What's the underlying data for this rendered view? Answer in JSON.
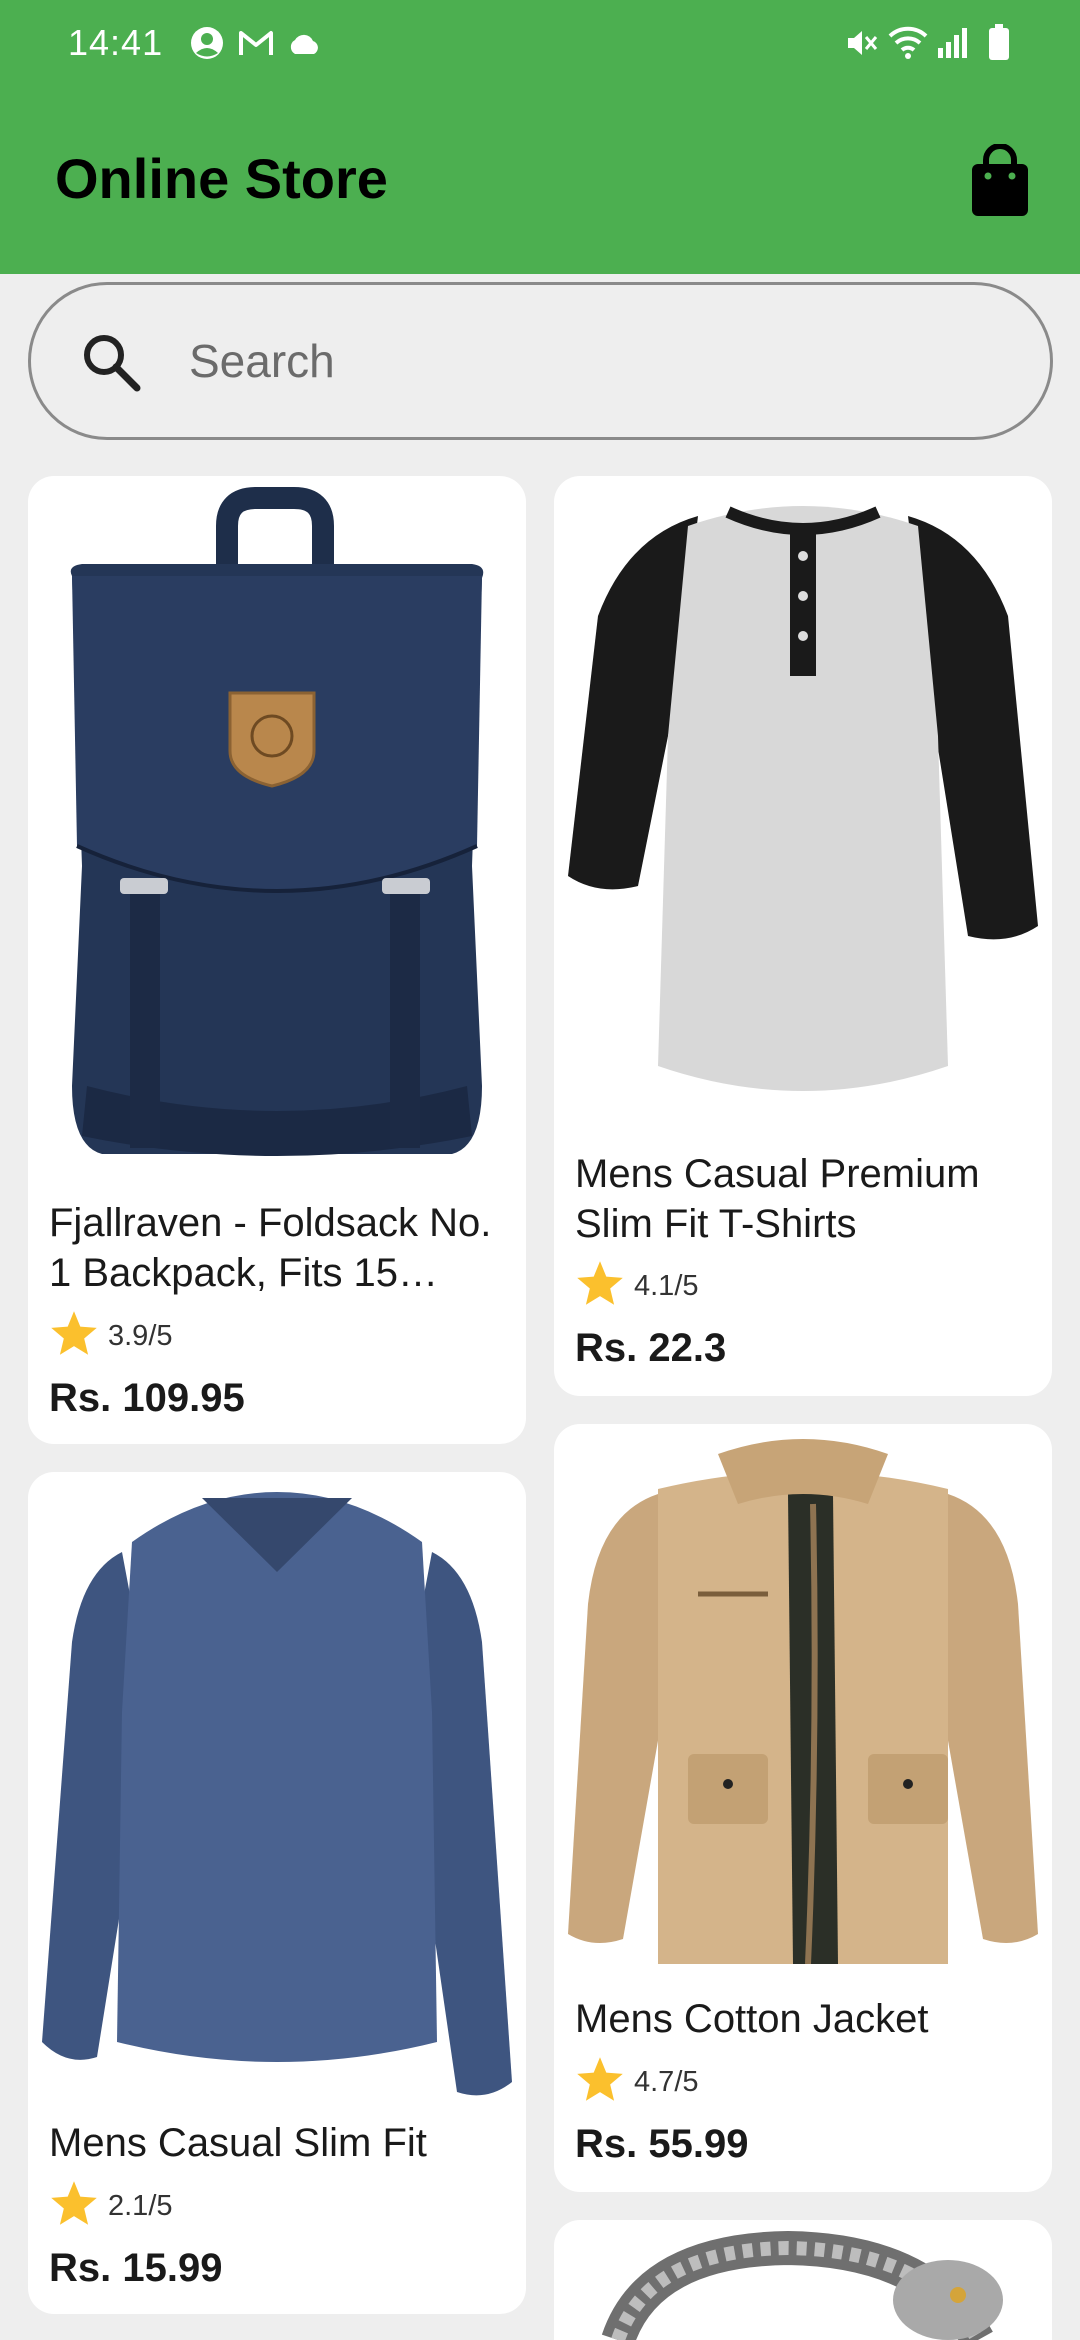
{
  "status_bar": {
    "time": "14:41",
    "icons": [
      "account-circle-icon",
      "gmail-icon",
      "cloud-icon",
      "mute-icon",
      "wifi-icon",
      "signal-icon",
      "battery-icon"
    ]
  },
  "app_bar": {
    "title": "Online Store",
    "cart_icon": "shopping-bag-icon",
    "color": "#4caf50"
  },
  "search": {
    "placeholder": "Search",
    "value": ""
  },
  "products": [
    {
      "name": "Fjallraven - Foldsack No. 1 Backpack, Fits 15 Laptops",
      "rating": "3.9/5",
      "price": "Rs. 109.95",
      "image": "navy-backpack"
    },
    {
      "name": "Mens Casual Premium Slim Fit T-Shirts",
      "rating": "4.1/5",
      "price": "Rs. 22.3",
      "image": "raglan-henley-shirt"
    },
    {
      "name": "Mens Casual Slim Fit",
      "rating": "2.1/5",
      "price": "Rs. 15.99",
      "image": "blue-long-sleeve-shirt"
    },
    {
      "name": "Mens Cotton Jacket",
      "rating": "4.7/5",
      "price": "Rs. 55.99",
      "image": "khaki-jacket"
    },
    {
      "name": "",
      "rating": "",
      "price": "",
      "image": "silver-dragon-bracelet"
    }
  ],
  "colors": {
    "star": "#fbc02d",
    "card": "#ffffff",
    "background": "#eeeeee"
  }
}
